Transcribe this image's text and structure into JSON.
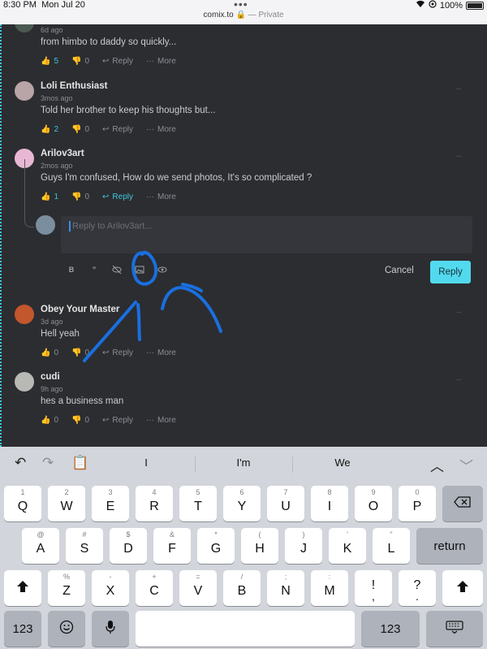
{
  "status_bar": {
    "time": "8:30 PM",
    "date": "Mon Jul 20",
    "url": "comix.to",
    "private_label": "— Private",
    "battery": "100%"
  },
  "comments": [
    {
      "user": "",
      "time": "6d ago",
      "text": "from himbo to daddy so quickly...",
      "upvotes": "5",
      "downvotes": "0",
      "upvote_active": true,
      "reply_label": "Reply",
      "more_label": "More"
    },
    {
      "user": "Loli Enthusiast",
      "time": "3mos ago",
      "text": "Told her brother to keep his thoughts but...",
      "upvotes": "2",
      "downvotes": "0",
      "upvote_active": true,
      "reply_label": "Reply",
      "more_label": "More"
    },
    {
      "user": "Arilov3art",
      "time": "2mos ago",
      "text": "Guys I'm confused, How do we send photos, It's so complicated ?",
      "upvotes": "1",
      "downvotes": "0",
      "upvote_active": true,
      "reply_label": "Reply",
      "more_label": "More"
    },
    {
      "user": "Obey Your Master",
      "time": "3d ago",
      "text": "Hell yeah",
      "upvotes": "0",
      "downvotes": "0",
      "upvote_active": false,
      "reply_label": "Reply",
      "more_label": "More"
    },
    {
      "user": "cudi",
      "time": "9h ago",
      "text": "hes a business man",
      "upvotes": "0",
      "downvotes": "0",
      "upvote_active": false,
      "reply_label": "Reply",
      "more_label": "More"
    }
  ],
  "reply_box": {
    "placeholder": "Reply to Arilov3art...",
    "cancel_label": "Cancel",
    "submit_label": "Reply",
    "toolbar": [
      "B",
      "”",
      "spoiler-icon",
      "image-icon",
      "eye-icon"
    ]
  },
  "keyboard": {
    "suggestions": [
      "I",
      "I'm",
      "We"
    ],
    "row1": [
      {
        "main": "Q",
        "hint": "1"
      },
      {
        "main": "W",
        "hint": "2"
      },
      {
        "main": "E",
        "hint": "3"
      },
      {
        "main": "R",
        "hint": "4"
      },
      {
        "main": "T",
        "hint": "5"
      },
      {
        "main": "Y",
        "hint": "6"
      },
      {
        "main": "U",
        "hint": "7"
      },
      {
        "main": "I",
        "hint": "8"
      },
      {
        "main": "O",
        "hint": "9"
      },
      {
        "main": "P",
        "hint": "0"
      }
    ],
    "row2": [
      {
        "main": "A",
        "hint": "@"
      },
      {
        "main": "S",
        "hint": "#"
      },
      {
        "main": "D",
        "hint": "$"
      },
      {
        "main": "F",
        "hint": "&"
      },
      {
        "main": "G",
        "hint": "*"
      },
      {
        "main": "H",
        "hint": "("
      },
      {
        "main": "J",
        "hint": ")"
      },
      {
        "main": "K",
        "hint": "'"
      },
      {
        "main": "L",
        "hint": "\""
      }
    ],
    "row3": [
      {
        "main": "Z",
        "hint": "%"
      },
      {
        "main": "X",
        "hint": "-"
      },
      {
        "main": "C",
        "hint": "+"
      },
      {
        "main": "V",
        "hint": "="
      },
      {
        "main": "B",
        "hint": "/"
      },
      {
        "main": "N",
        "hint": ";"
      },
      {
        "main": "M",
        "hint": ":"
      },
      {
        "main": "!",
        "hint": ","
      },
      {
        "main": "?",
        "hint": "."
      }
    ],
    "return_label": "return",
    "numbers_label": "123"
  },
  "colors": {
    "accent": "#53d9ee",
    "background": "#2b2d31",
    "annotation": "#1a6fe0"
  }
}
